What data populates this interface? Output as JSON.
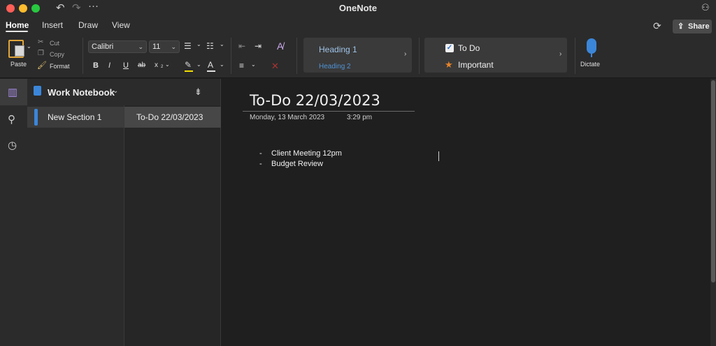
{
  "app": {
    "title": "OneNote"
  },
  "menu_tabs": [
    {
      "label": "Home"
    },
    {
      "label": "Insert"
    },
    {
      "label": "Draw"
    },
    {
      "label": "View"
    }
  ],
  "share": {
    "label": "Share"
  },
  "ribbon": {
    "paste_label": "Paste",
    "cut_label": "Cut",
    "copy_label": "Copy",
    "format_label": "Format",
    "font_family": "Calibri",
    "font_size": "11",
    "bold": "B",
    "italic": "I",
    "underline": "U",
    "strikethrough": "ab",
    "subscript": "x",
    "heading1": "Heading 1",
    "heading2": "Heading 2",
    "tag_todo": "To Do",
    "tag_important": "Important",
    "dictate_label": "Dictate"
  },
  "notebook": {
    "name": "Work Notebook",
    "sections": [
      {
        "label": "New Section 1"
      }
    ],
    "pages": [
      {
        "label": "To-Do 22/03/2023"
      }
    ]
  },
  "page": {
    "title": "To-Do 22/03/2023",
    "date": "Monday, 13 March 2023",
    "time": "3:29 pm",
    "list": [
      {
        "bullet": "-",
        "text": "Client Meeting 12pm"
      },
      {
        "bullet": "-",
        "text": "Budget Review"
      }
    ]
  }
}
